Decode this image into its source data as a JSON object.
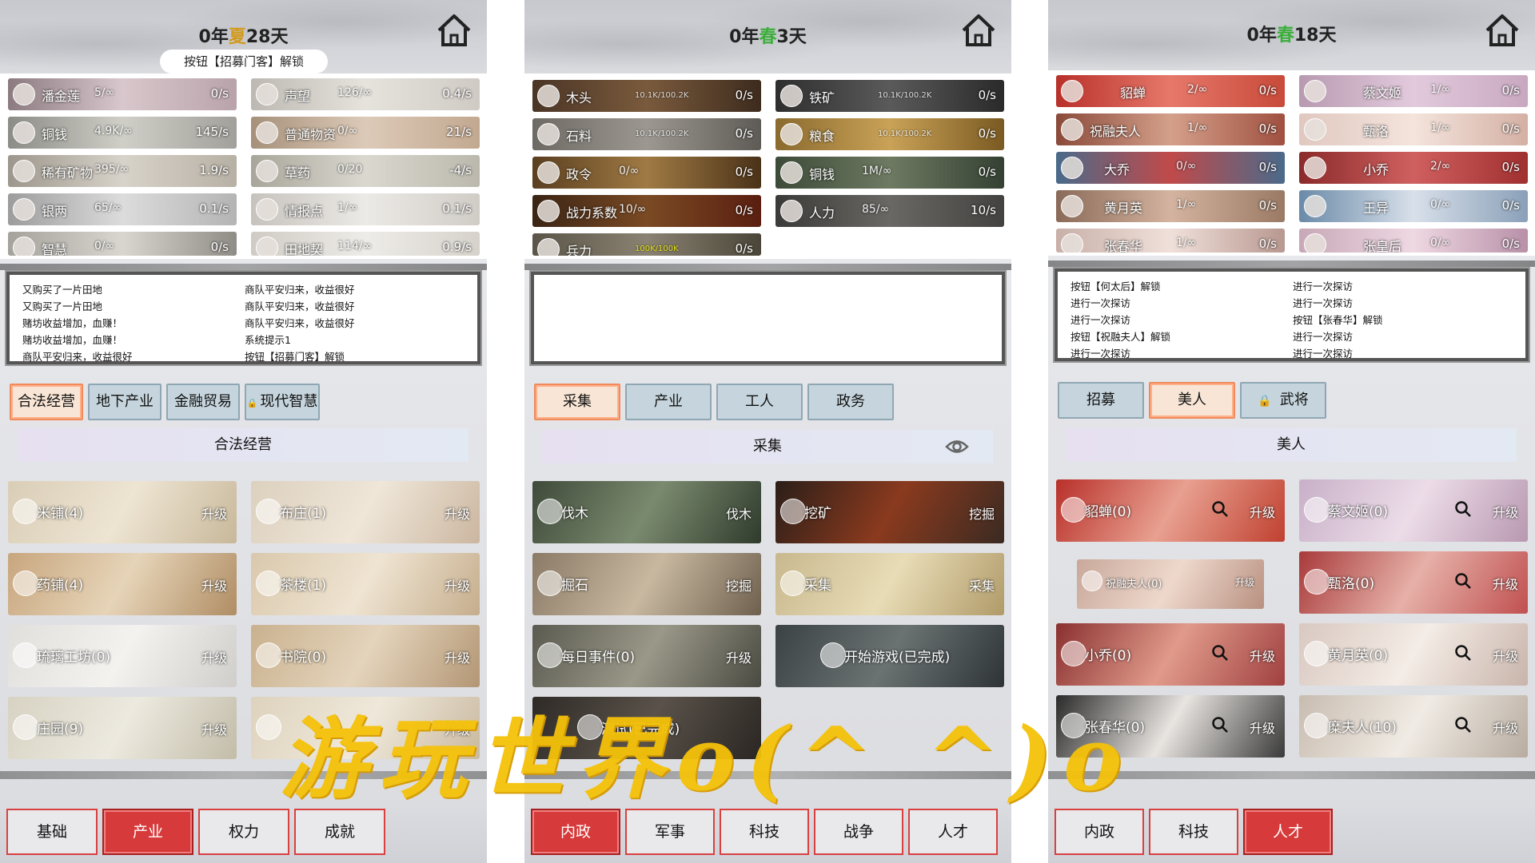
{
  "panel1": {
    "date_prefix": "0年",
    "season": "夏",
    "date_suffix": "28天",
    "tip": "按钮【招募门客】解锁",
    "resources": [
      {
        "name": "潘金莲",
        "count": "5/∞",
        "rate": "0/s"
      },
      {
        "name": "声望",
        "count": "126/∞",
        "rate": "0.4/s"
      },
      {
        "name": "铜钱",
        "count": "4.9K/∞",
        "rate": "145/s"
      },
      {
        "name": "普通物资",
        "count": "0/∞",
        "rate": "21/s"
      },
      {
        "name": "稀有矿物",
        "count": "395/∞",
        "rate": "1.9/s"
      },
      {
        "name": "草药",
        "count": "0/20",
        "rate": "-4/s"
      },
      {
        "name": "银两",
        "count": "65/∞",
        "rate": "0.1/s"
      },
      {
        "name": "情报点",
        "count": "1/∞",
        "rate": "0.1/s"
      },
      {
        "name": "智慧",
        "count": "0/∞",
        "rate": "0/s"
      },
      {
        "name": "田地契",
        "count": "114/∞",
        "rate": "0.9/s"
      }
    ],
    "log_left": [
      "又购买了一片田地",
      "又购买了一片田地",
      "赌坊收益增加，血赚！",
      "赌坊收益增加，血赚！",
      "商队平安归来，收益很好"
    ],
    "log_right": [
      "商队平安归来，收益很好",
      "商队平安归来，收益很好",
      "商队平安归来，收益很好",
      "系统提示1",
      "按钮【招募门客】解锁"
    ],
    "tabs": [
      "合法经营",
      "地下产业",
      "金融贸易",
      "现代智慧"
    ],
    "section": "合法经营",
    "cards": [
      {
        "name": "米铺(4)",
        "action": "升级"
      },
      {
        "name": "布庄(1)",
        "action": "升级"
      },
      {
        "name": "药铺(4)",
        "action": "升级"
      },
      {
        "name": "茶楼(1)",
        "action": "升级"
      },
      {
        "name": "琉璃工坊(0)",
        "action": "升级"
      },
      {
        "name": "书院(0)",
        "action": "升级"
      },
      {
        "name": "庄园(9)",
        "action": "升级"
      },
      {
        "name": "",
        "action": "升级"
      }
    ],
    "bottom": [
      "基础",
      "产业",
      "权力",
      "成就"
    ]
  },
  "panel2": {
    "date_prefix": "0年",
    "season": "春",
    "date_suffix": "3天",
    "resources": [
      {
        "name": "木头",
        "mid": "10.1K/100.2K",
        "rate": "0/s"
      },
      {
        "name": "铁矿",
        "mid": "10.1K/100.2K",
        "rate": "0/s"
      },
      {
        "name": "石料",
        "mid": "10.1K/100.2K",
        "rate": "0/s"
      },
      {
        "name": "粮食",
        "mid": "10.1K/100.2K",
        "rate": "0/s"
      },
      {
        "name": "政令",
        "count": "0/∞",
        "rate": "0/s"
      },
      {
        "name": "铜钱",
        "count": "1M/∞",
        "rate": "0/s"
      },
      {
        "name": "战力系数",
        "count": "10/∞",
        "rate": "0/s"
      },
      {
        "name": "人力",
        "count": "85/∞",
        "rate": "10/s"
      },
      {
        "name": "兵力",
        "mid": "100K/100K",
        "rate": "0/s"
      }
    ],
    "tabs": [
      "采集",
      "产业",
      "工人",
      "政务"
    ],
    "section": "采集",
    "cards": [
      {
        "name": "伐木",
        "action": "伐木"
      },
      {
        "name": "挖矿",
        "action": "挖掘"
      },
      {
        "name": "掘石",
        "action": "挖掘"
      },
      {
        "name": "采集",
        "action": "采集"
      },
      {
        "name": "每日事件(0)",
        "action": "升级"
      },
      {
        "name": "开始游戏(已完成)",
        "action": ""
      },
      {
        "name": "测试(已完成)",
        "action": ""
      }
    ],
    "bottom": [
      "内政",
      "军事",
      "科技",
      "战争",
      "人才"
    ]
  },
  "panel3": {
    "date_prefix": "0年",
    "season": "春",
    "date_suffix": "18天",
    "resources": [
      {
        "name": "貂蝉",
        "count": "2/∞",
        "rate": "0/s"
      },
      {
        "name": "蔡文姬",
        "count": "1/∞",
        "rate": "0/s"
      },
      {
        "name": "祝融夫人",
        "count": "1/∞",
        "rate": "0/s"
      },
      {
        "name": "甄洛",
        "count": "1/∞",
        "rate": "0/s"
      },
      {
        "name": "大乔",
        "count": "0/∞",
        "rate": "0/s"
      },
      {
        "name": "小乔",
        "count": "2/∞",
        "rate": "0/s"
      },
      {
        "name": "黄月英",
        "count": "1/∞",
        "rate": "0/s"
      },
      {
        "name": "王异",
        "count": "0/∞",
        "rate": "0/s"
      },
      {
        "name": "张春华",
        "count": "1/∞",
        "rate": "0/s"
      },
      {
        "name": "张皇后",
        "count": "0/∞",
        "rate": "0/s"
      }
    ],
    "log_left": [
      "按钮【何太后】解锁",
      "进行一次探访",
      "进行一次探访",
      "按钮【祝融夫人】解锁",
      "进行一次探访"
    ],
    "log_right": [
      "进行一次探访",
      "进行一次探访",
      "按钮【张春华】解锁",
      "进行一次探访",
      "进行一次探访"
    ],
    "tabs": [
      "招募",
      "美人",
      "武将"
    ],
    "section": "美人",
    "cards": [
      {
        "name": "貂蝉(0)",
        "action": "升级"
      },
      {
        "name": "蔡文姬(0)",
        "action": "升级"
      },
      {
        "name": "祝融夫人(0)",
        "action": "升级"
      },
      {
        "name": "甄洛(0)",
        "action": "升级"
      },
      {
        "name": "小乔(0)",
        "action": "升级"
      },
      {
        "name": "黄月英(0)",
        "action": "升级"
      },
      {
        "name": "张春华(0)",
        "action": "升级"
      },
      {
        "name": "糜夫人(10)",
        "action": "升级"
      }
    ],
    "bottom": [
      "内政",
      "科技",
      "人才"
    ]
  },
  "watermark": "游玩世界o(^ ^)o",
  "colors": {
    "accent_red": "#d63a3a",
    "tab_active": "#f08a5a",
    "tab_bg": "#c6d5dd",
    "summer": "#d29a1c",
    "spring": "#3cae3c",
    "watermark": "#f5c20a"
  },
  "icons": [
    "home-icon",
    "search-icon",
    "eye-icon",
    "lock-icon"
  ]
}
